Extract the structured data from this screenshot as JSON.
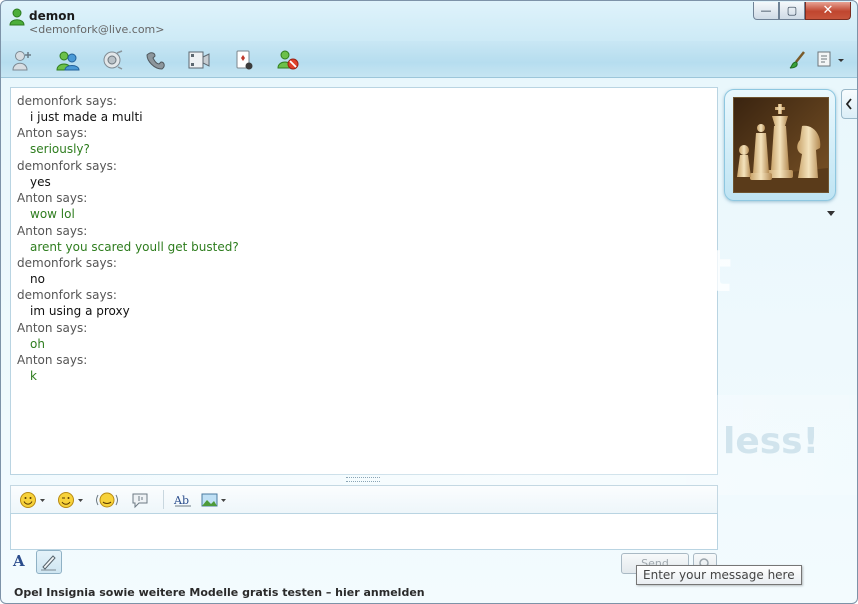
{
  "window": {
    "contact_name": "demon",
    "contact_email": "<demonfork@live.com>",
    "controls": {
      "minimize": "—",
      "maximize": "▢",
      "close": "✕"
    }
  },
  "toolbar": {
    "icons": [
      "invite-contact-icon",
      "share-contacts-icon",
      "webcam-icon",
      "call-icon",
      "video-icon",
      "games-icon",
      "block-contact-icon"
    ],
    "right_icons": [
      "paintbrush-icon",
      "menu-icon"
    ]
  },
  "conversation": {
    "messages": [
      {
        "sender": "demonfork says:",
        "text": "i just made a multi",
        "self": true
      },
      {
        "sender": "Anton says:",
        "text": "seriously?",
        "self": false
      },
      {
        "sender": "demonfork says:",
        "text": "yes",
        "self": true
      },
      {
        "sender": "Anton says:",
        "text": "wow lol",
        "self": false
      },
      {
        "sender": "Anton says:",
        "text": "arent you scared youll get busted?",
        "self": false
      },
      {
        "sender": "demonfork says:",
        "text": "no",
        "self": true
      },
      {
        "sender": "demonfork says:",
        "text": "im using a proxy",
        "self": true
      },
      {
        "sender": "Anton says:",
        "text": "oh",
        "self": false
      },
      {
        "sender": "Anton says:",
        "text": "k",
        "self": false
      }
    ],
    "colors": {
      "self_text": "#111111",
      "other_text": "#2e7d1e",
      "sender": "#555555"
    }
  },
  "format_bar": {
    "icons": [
      "emoticon-icon",
      "wink-icon",
      "nudge-icon",
      "voice-clip-icon",
      "font-style-icon",
      "background-icon"
    ]
  },
  "compose": {
    "value": "",
    "font_label": "A",
    "send_label": "Send",
    "tooltip": "Enter your message here"
  },
  "watermark": {
    "top": "t",
    "bottom": "less!"
  },
  "ad": {
    "text": "Opel Insignia sowie weitere Modelle gratis testen – hier anmelden"
  }
}
